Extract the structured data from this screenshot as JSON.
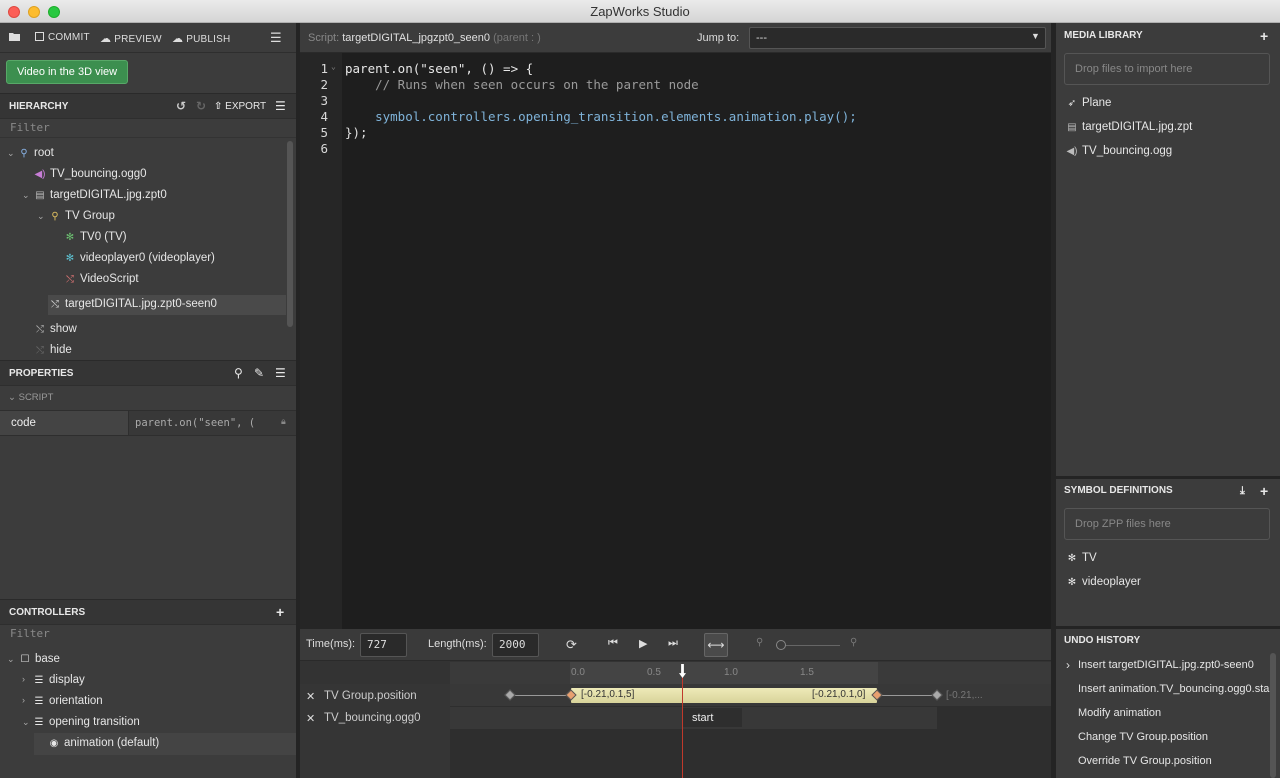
{
  "window": {
    "title": "ZapWorks Studio"
  },
  "toolbar": {
    "commit": "COMMIT",
    "preview": "PREVIEW",
    "publish": "PUBLISH"
  },
  "view_button": "Video in the 3D view",
  "hierarchy": {
    "title": "HIERARCHY",
    "export": "EXPORT",
    "filter": "Filter",
    "items": [
      {
        "label": "root",
        "icon": "hierarchy-icon"
      },
      {
        "label": "TV_bouncing.ogg0",
        "icon": "audio-icon"
      },
      {
        "label": "targetDIGITAL.jpg.zpt0",
        "icon": "file-icon"
      },
      {
        "label": "TV Group",
        "icon": "group-icon"
      },
      {
        "label": "TV0 (TV)",
        "icon": "gear-icon"
      },
      {
        "label": "videoplayer0 (videoplayer)",
        "icon": "gear-icon"
      },
      {
        "label": "VideoScript",
        "icon": "script-icon"
      },
      {
        "label": "targetDIGITAL.jpg.zpt0-seen0",
        "icon": "script-icon"
      },
      {
        "label": "show",
        "icon": "script-icon"
      },
      {
        "label": "hide",
        "icon": "script-icon"
      }
    ]
  },
  "properties": {
    "title": "PROPERTIES",
    "section": "SCRIPT",
    "row_label": "code",
    "row_value": "parent.on(\"seen\", ("
  },
  "controllers": {
    "title": "CONTROLLERS",
    "filter": "Filter",
    "items": [
      {
        "label": "base"
      },
      {
        "label": "display"
      },
      {
        "label": "orientation"
      },
      {
        "label": "opening transition"
      },
      {
        "label": "animation (default)"
      }
    ]
  },
  "editor": {
    "script_prefix": "Script:",
    "script_name": "targetDIGITAL_jpgzpt0_seen0",
    "parent_hint": "(parent : )",
    "jump_label": "Jump to:",
    "jump_value": "---",
    "lines": [
      {
        "n": "1",
        "text": "parent.on(\"seen\", () => {"
      },
      {
        "n": "2",
        "text": "    // Runs when seen occurs on the parent node"
      },
      {
        "n": "3",
        "text": ""
      },
      {
        "n": "4",
        "text": "    symbol.controllers.opening_transition.elements.animation.play();"
      },
      {
        "n": "5",
        "text": "});"
      },
      {
        "n": "6",
        "text": ""
      }
    ]
  },
  "timeline": {
    "time_label": "Time(ms):",
    "time_value": "727",
    "length_label": "Length(ms):",
    "length_value": "2000",
    "ruler": [
      "0.0",
      "0.5",
      "1.0",
      "1.5"
    ],
    "tracks": [
      {
        "label": "TV Group.position",
        "kf1": "[-0.21,0.1,5]",
        "kf2": "[-0.21,0.1,0]",
        "kf3": "[-0.21,..."
      },
      {
        "label": "TV_bouncing.ogg0",
        "event": "start"
      }
    ]
  },
  "media_library": {
    "title": "MEDIA LIBRARY",
    "drop": "Drop files to import here",
    "items": [
      {
        "label": "Plane",
        "icon": "rocket-icon"
      },
      {
        "label": "targetDIGITAL.jpg.zpt",
        "icon": "file-icon"
      },
      {
        "label": "TV_bouncing.ogg",
        "icon": "audio-icon"
      }
    ]
  },
  "symbol_definitions": {
    "title": "SYMBOL DEFINITIONS",
    "drop": "Drop ZPP files here",
    "items": [
      {
        "label": "TV"
      },
      {
        "label": "videoplayer"
      }
    ]
  },
  "undo_history": {
    "title": "UNDO HISTORY",
    "items": [
      "Insert targetDIGITAL.jpg.zpt0-seen0",
      "Insert animation.TV_bouncing.ogg0.start",
      "Modify animation",
      "Change TV Group.position",
      "Override TV Group.position"
    ]
  },
  "colors": {
    "accent_green": "#3c8f4f",
    "playhead": "#c0392b",
    "keyframe_fill": "#e8e4b0"
  }
}
